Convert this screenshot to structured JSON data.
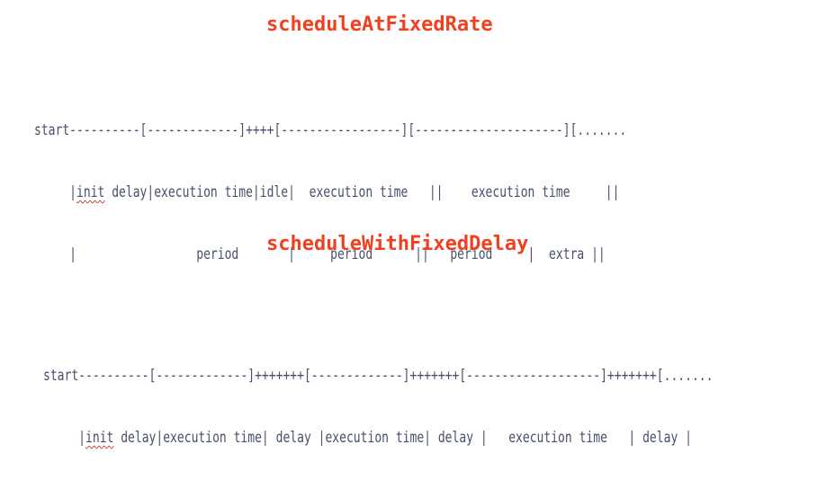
{
  "colors": {
    "title": "#f0401f",
    "timeline_text": "#474f6b",
    "spell_squiggle": "#c0392b"
  },
  "fixed_rate": {
    "title": "scheduleAtFixedRate",
    "lines": [
      "start----------[-------------]++++[-----------------][---------------------][.......",
      "     |",
      "     |                 period       |     period      ||   period     |  extra ||"
    ],
    "line2_flagged_word": "init",
    "line2_rest": " delay|execution time|idle|  execution time   ||    execution time     ||"
  },
  "fixed_delay": {
    "title": "scheduleWithFixedDelay",
    "line1": "start----------[-------------]+++++++[-------------]+++++++[-------------------]+++++++[.......",
    "line2_prefix": "     |",
    "line2_flagged_word": "init",
    "line2_rest": " delay|execution time| delay |execution time| delay |   execution time   | delay |"
  }
}
